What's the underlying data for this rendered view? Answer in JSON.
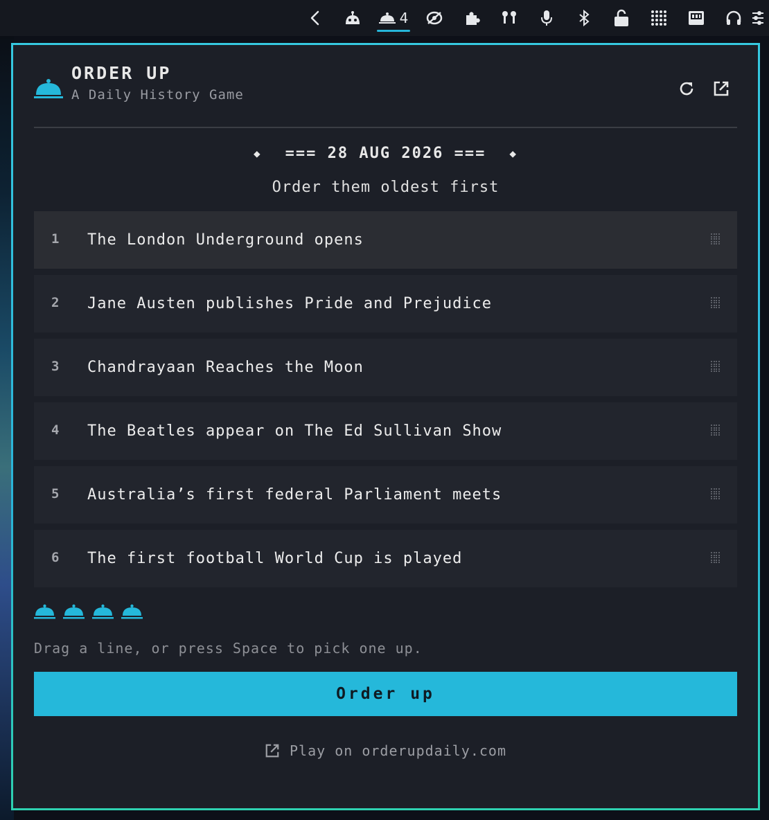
{
  "menubar": {
    "active_count": "4",
    "icons": [
      "chevron-left-icon",
      "robot-icon",
      "cloche-icon",
      "eye-off-icon",
      "puzzle-icon",
      "earbuds-icon",
      "microphone-icon",
      "bluetooth-icon",
      "lock-open-icon",
      "grid-dots-icon",
      "screen-icon",
      "headphones-icon",
      "sliders-icon"
    ]
  },
  "app": {
    "title": "ORDER UP",
    "subtitle": "A Daily History Game",
    "accent_color": "#25b8da"
  },
  "game": {
    "date": "=== 28 AUG 2026 ===",
    "instructions": "Order them oldest first",
    "events": [
      {
        "num": "1",
        "text": "The London Underground opens"
      },
      {
        "num": "2",
        "text": "Jane Austen publishes Pride and Prejudice"
      },
      {
        "num": "3",
        "text": "Chandrayaan Reaches the Moon"
      },
      {
        "num": "4",
        "text": "The Beatles appear on The Ed Sullivan Show"
      },
      {
        "num": "5",
        "text": "Australia’s first federal Parliament meets"
      },
      {
        "num": "6",
        "text": "The first football World Cup is played"
      }
    ],
    "lives_remaining": 4,
    "hint": "Drag a line, or press Space to pick one up.",
    "submit_label": "Order up",
    "footer_link": "Play on orderupdaily.com"
  }
}
